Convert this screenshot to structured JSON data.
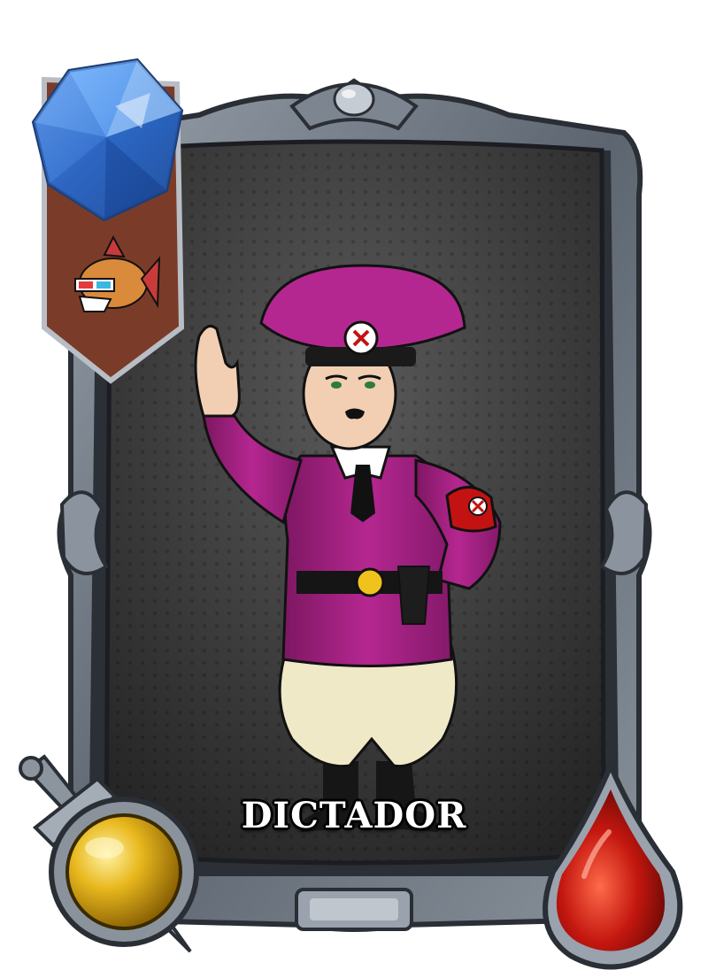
{
  "card": {
    "name": "DICTADOR",
    "art_subject": "uniformed-officer-saluting",
    "mana_gem": {
      "icon": "blue-crystal-gem-icon",
      "value": ""
    },
    "tribe_banner": {
      "icon": "piranha-with-3d-glasses-icon"
    },
    "attack": {
      "icon": "sword-gold-orb-icon",
      "value": ""
    },
    "health": {
      "icon": "red-blood-drop-icon",
      "value": ""
    }
  },
  "colors": {
    "frame": "#6b7380",
    "frame_dark": "#3a3f48",
    "art_background": "#3b3b3b",
    "uniform": "#a0207e",
    "gem_blue": "#3f7fd6",
    "attack_gold": "#e0b21a",
    "health_red": "#c4170f",
    "banner": "#7a3c28"
  }
}
